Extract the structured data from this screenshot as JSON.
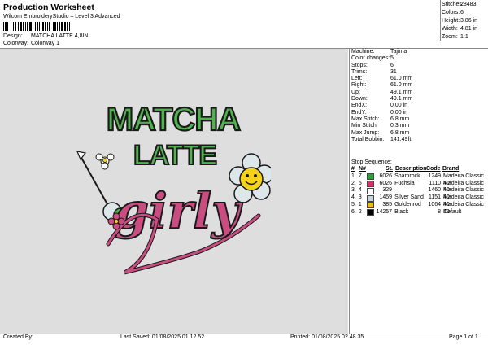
{
  "header": {
    "title": "Production Worksheet",
    "subtitle": "Wilcom EmbroideryStudio – Level 3 Advanced",
    "design_label": "Design:",
    "design_value": "MATCHA LATTE 4,8IN",
    "colorway_label": "Colorway:",
    "colorway_value": "Colorway 1"
  },
  "summary": [
    {
      "label": "Stitches:",
      "value": "28483"
    },
    {
      "label": "Colors:",
      "value": "6"
    },
    {
      "label": "Height:",
      "value": "3.86 in"
    },
    {
      "label": "Width:",
      "value": "4.81 in"
    },
    {
      "label": "Zoom:",
      "value": "1:1"
    }
  ],
  "machine_info": [
    {
      "label": "Machine:",
      "value": "Tajima"
    },
    {
      "label": "Color changes:",
      "value": "5"
    },
    {
      "label": "Stops:",
      "value": "6"
    },
    {
      "label": "Trims:",
      "value": "31"
    },
    {
      "label": "Left:",
      "value": "61.0 mm"
    },
    {
      "label": "Right:",
      "value": "61.0 mm"
    },
    {
      "label": "Up:",
      "value": "49.1 mm"
    },
    {
      "label": "Down:",
      "value": "49.1 mm"
    },
    {
      "label": "EndX:",
      "value": "0.00 in"
    },
    {
      "label": "EndY:",
      "value": "0.00 in"
    },
    {
      "label": "Max Stitch:",
      "value": "6.8 mm"
    },
    {
      "label": "Min Stitch:",
      "value": "0.3 mm"
    },
    {
      "label": "Max Jump:",
      "value": "6.8 mm"
    },
    {
      "label": "Total Bobbin:",
      "value": "141.49ft"
    }
  ],
  "stop_sequence": {
    "title": "Stop Sequence:",
    "headers": {
      "n": "#",
      "no": "N#",
      "st": "St.",
      "desc": "Description",
      "code": "Code",
      "brand": "Brand"
    },
    "rows": [
      {
        "n": "1.",
        "no": "7",
        "color": "#2e9e3a",
        "st": "6026",
        "desc": "Shamrock",
        "code": "1249",
        "brand": "Madeira Classic 40"
      },
      {
        "n": "2.",
        "no": "5",
        "color": "#c8366a",
        "st": "6026",
        "desc": "Fuchsia",
        "code": "1110",
        "brand": "Madeira Classic 40"
      },
      {
        "n": "3.",
        "no": "4",
        "color": "#ffffff",
        "st": "329",
        "desc": "",
        "code": "1460",
        "brand": "Madeira Classic 40"
      },
      {
        "n": "4.",
        "no": "3",
        "color": "#c6d4da",
        "st": "1459",
        "desc": "Silver Sand",
        "code": "1151",
        "brand": "Madeira Classic 40"
      },
      {
        "n": "5.",
        "no": "1",
        "color": "#f2b81c",
        "st": "385",
        "desc": "Goldenrod",
        "code": "1064",
        "brand": "Madeira Classic 40"
      },
      {
        "n": "6.",
        "no": "2",
        "color": "#000000",
        "st": "14257",
        "desc": "Black",
        "code": "8",
        "brand": "Default"
      }
    ]
  },
  "design_art": {
    "line1": "MATCHA",
    "line2": "LATTE",
    "line3": "girly",
    "colors": {
      "green": "#4fb34d",
      "pink": "#c94d80",
      "outline": "#1a1a1a",
      "flower": "#dde6e8",
      "smile": "#f6d21a"
    }
  },
  "footer": {
    "created_by_label": "Created By:",
    "last_saved_label": "Last Saved:",
    "last_saved_value": "01/08/2025 01.12.52",
    "printed_label": "Printed:",
    "printed_value": "01/08/2025 02.48.35",
    "page_label": "Page 1 of 1"
  }
}
